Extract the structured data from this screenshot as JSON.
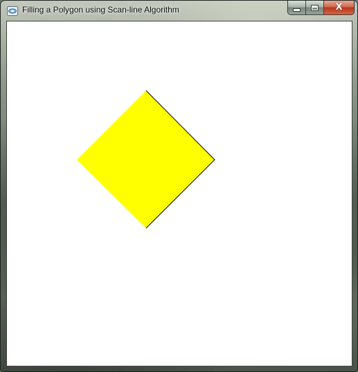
{
  "window": {
    "title": "Filling a Polygon using Scan-line Algorithm",
    "app_icon": "opengl-window-icon",
    "controls": {
      "minimize": "minimize-icon",
      "maximize": "maximize-icon",
      "close": "X"
    }
  },
  "canvas": {
    "background_color": "#ffffff",
    "polygon": {
      "shape": "diamond",
      "fill_color": "#ffff00",
      "edge_color": "#000000"
    }
  }
}
